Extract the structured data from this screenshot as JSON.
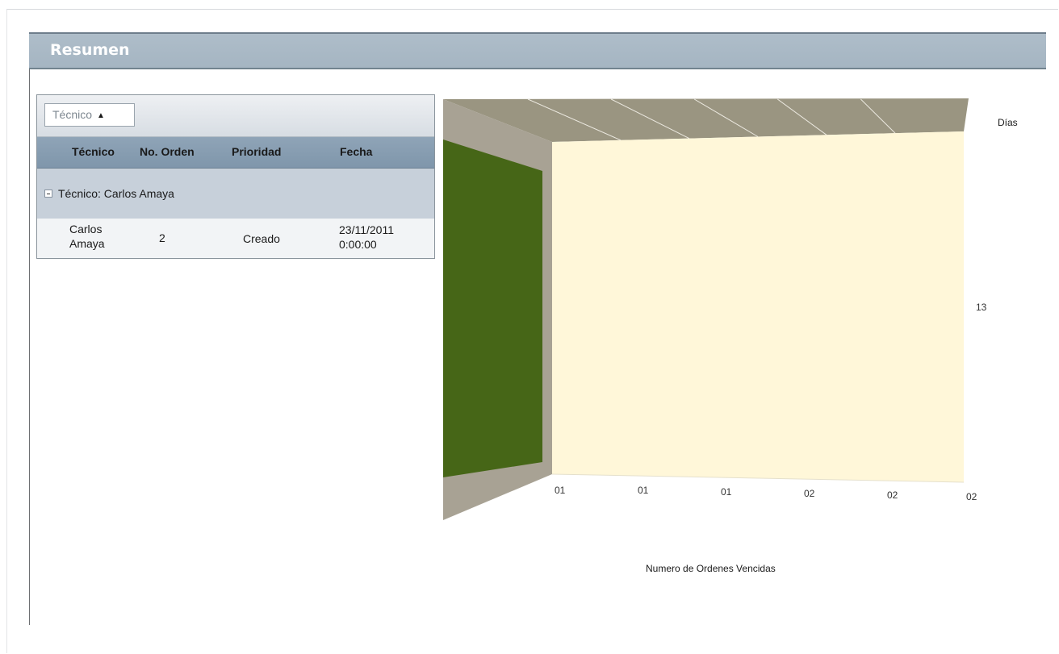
{
  "panel": {
    "title": "Resumen"
  },
  "grid": {
    "group_chip": {
      "label": "Técnico",
      "sort_icon": "triangle-up-icon"
    },
    "columns": [
      "Técnico",
      "No. Orden",
      "Prioridad",
      "Fecha"
    ],
    "group": {
      "label": "Técnico: Carlos Amaya",
      "toggle_icon": "minus-box-icon"
    },
    "rows": [
      {
        "tecnico_line1": "Carlos",
        "tecnico_line2": "Amaya",
        "no_orden": "2",
        "prioridad": "Creado",
        "fecha_line1": "23/11/2011",
        "fecha_line2": "0:00:00"
      }
    ]
  },
  "chart_data": {
    "type": "bar",
    "title": "",
    "xlabel": "Numero de Ordenes Vencidas",
    "ylabel": "Días",
    "categories": [
      "01",
      "01",
      "01",
      "02",
      "02",
      "02"
    ],
    "y_ticks": [
      "13"
    ],
    "series": [
      {
        "values": [
          13,
          13,
          13,
          13,
          13,
          13
        ]
      }
    ],
    "colors": {
      "plot_back_wall": "#fff7d9",
      "side_wall": "#a8a294",
      "top_wall": "#9a9581",
      "bar_side": "#466617"
    },
    "three_d": true,
    "grid": true
  }
}
